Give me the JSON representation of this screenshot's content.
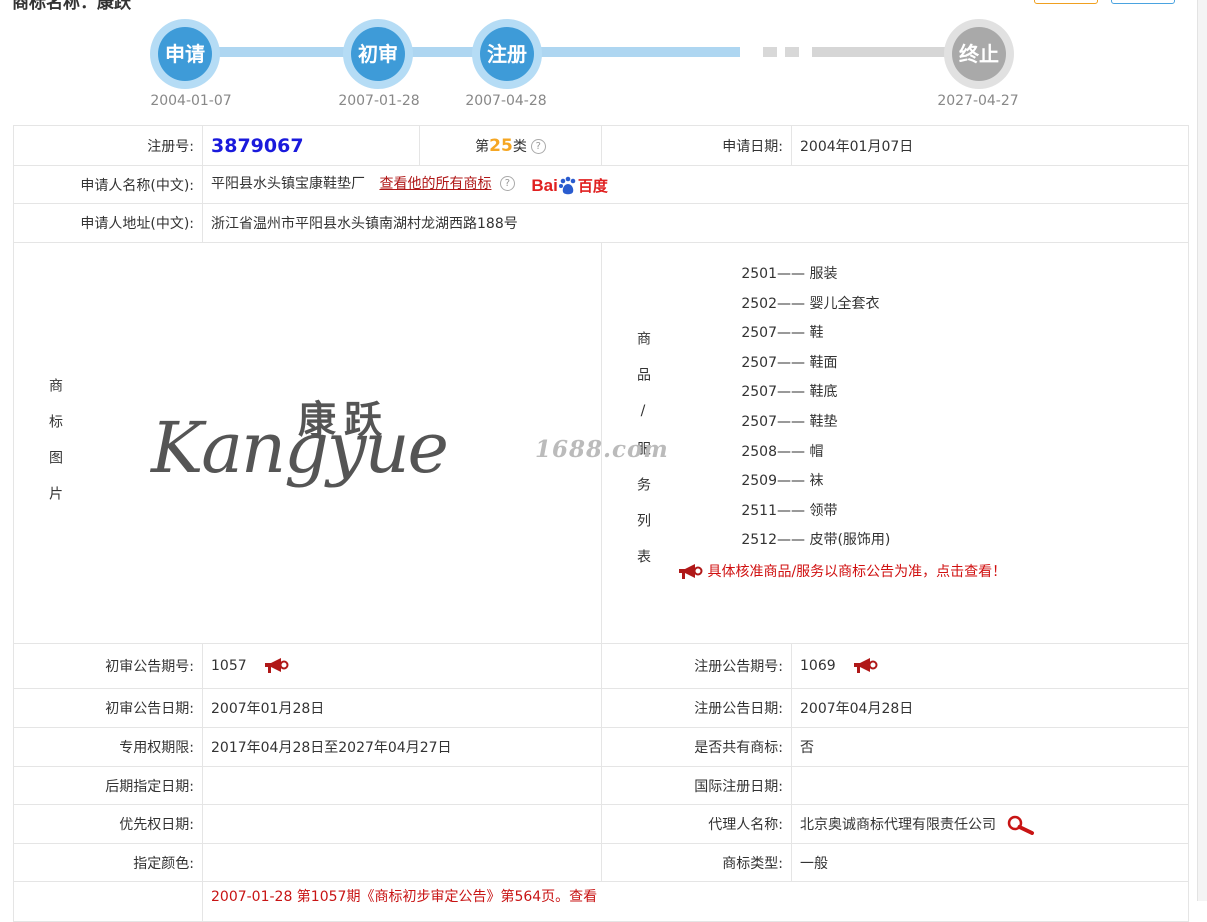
{
  "header": {
    "title": "商标名称：康跃"
  },
  "timeline": {
    "steps": [
      {
        "label": "申请",
        "date": "2004-01-07",
        "state": "done"
      },
      {
        "label": "初审",
        "date": "2007-01-28",
        "state": "done"
      },
      {
        "label": "注册",
        "date": "2007-04-28",
        "state": "done"
      },
      {
        "label": "终止",
        "date": "2027-04-27",
        "state": "pending"
      }
    ]
  },
  "info": {
    "reg_no_label": "注册号:",
    "reg_no": "3879067",
    "class_prefix": "第",
    "class_num": "25",
    "class_suffix": "类",
    "apply_date_label": "申请日期:",
    "apply_date": "2004年01月07日",
    "applicant_name_label": "申请人名称(中文):",
    "applicant_name": "平阳县水头镇宝康鞋垫厂",
    "view_all_link": "查看他的所有商标",
    "baidu_part1": "Bai",
    "baidu_part2": "百度",
    "applicant_addr_label": "申请人地址(中文):",
    "applicant_addr": "浙江省温州市平阳县水头镇南湖村龙湖西路188号",
    "image_label": "商标图片",
    "logo_cn": "康跃",
    "logo_en": "Kangyue",
    "watermark": "1688.com",
    "goods_label": "商品/服务列表",
    "goods": [
      {
        "code": "2501",
        "name": "服装"
      },
      {
        "code": "2502",
        "name": "婴儿全套衣"
      },
      {
        "code": "2507",
        "name": "鞋"
      },
      {
        "code": "2507",
        "name": "鞋面"
      },
      {
        "code": "2507",
        "name": "鞋底"
      },
      {
        "code": "2507",
        "name": "鞋垫"
      },
      {
        "code": "2508",
        "name": "帽"
      },
      {
        "code": "2509",
        "name": "袜"
      },
      {
        "code": "2511",
        "name": "领带"
      },
      {
        "code": "2512",
        "name": "皮带(服饰用)"
      }
    ],
    "goods_dash": "——",
    "goods_note": "具体核准商品/服务以商标公告为准，点击查看！",
    "prelim_no_label": "初审公告期号:",
    "prelim_no": "1057",
    "reg_pub_no_label": "注册公告期号:",
    "reg_pub_no": "1069",
    "prelim_date_label": "初审公告日期:",
    "prelim_date": "2007年01月28日",
    "reg_pub_date_label": "注册公告日期:",
    "reg_pub_date": "2007年04月28日",
    "exclusive_label": "专用权期限:",
    "exclusive": "2017年04月28日至2027年04月27日",
    "shared_label": "是否共有商标:",
    "shared": "否",
    "later_date_label": "后期指定日期:",
    "later_date": "",
    "intl_date_label": "国际注册日期:",
    "intl_date": "",
    "priority_label": "优先权日期:",
    "priority": "",
    "agent_label": "代理人名称:",
    "agent": "北京奥诚商标代理有限责任公司",
    "color_label": "指定颜色:",
    "color": "",
    "type_label": "商标类型:",
    "type": "一般",
    "bottom_note": "2007-01-28 第1057期《商标初步审定公告》第564页。",
    "bottom_view": "查看"
  },
  "colors": {
    "step_active": "#3e9bd8",
    "step_pending": "#a9a9a9",
    "reg_no": "#1a1adc",
    "class_num": "#f5a623",
    "link_red": "#b01818",
    "note_red": "#d01010"
  }
}
